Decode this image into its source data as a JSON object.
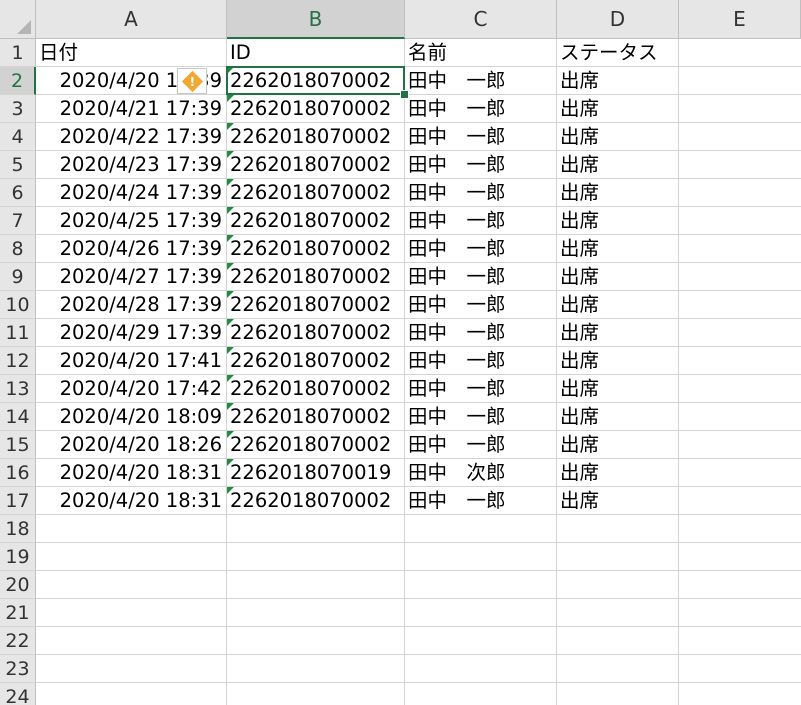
{
  "columns": [
    "A",
    "B",
    "C",
    "D",
    "E"
  ],
  "selected_column": "B",
  "row_numbers": [
    "1",
    "2",
    "3",
    "4",
    "5",
    "6",
    "7",
    "8",
    "9",
    "10",
    "11",
    "12",
    "13",
    "14",
    "15",
    "16",
    "17",
    "18",
    "19",
    "20",
    "21",
    "22",
    "23",
    "24"
  ],
  "selected_row": "2",
  "header_row": {
    "A": "日付",
    "B": "ID",
    "C": "名前",
    "D": "ステータス"
  },
  "rows": [
    {
      "date": "2020/4/20 17:39",
      "id": "2262018070002",
      "name": "田中　一郎",
      "status": "出席"
    },
    {
      "date": "2020/4/21 17:39",
      "id": "2262018070002",
      "name": "田中　一郎",
      "status": "出席"
    },
    {
      "date": "2020/4/22 17:39",
      "id": "2262018070002",
      "name": "田中　一郎",
      "status": "出席"
    },
    {
      "date": "2020/4/23 17:39",
      "id": "2262018070002",
      "name": "田中　一郎",
      "status": "出席"
    },
    {
      "date": "2020/4/24 17:39",
      "id": "2262018070002",
      "name": "田中　一郎",
      "status": "出席"
    },
    {
      "date": "2020/4/25 17:39",
      "id": "2262018070002",
      "name": "田中　一郎",
      "status": "出席"
    },
    {
      "date": "2020/4/26 17:39",
      "id": "2262018070002",
      "name": "田中　一郎",
      "status": "出席"
    },
    {
      "date": "2020/4/27 17:39",
      "id": "2262018070002",
      "name": "田中　一郎",
      "status": "出席"
    },
    {
      "date": "2020/4/28 17:39",
      "id": "2262018070002",
      "name": "田中　一郎",
      "status": "出席"
    },
    {
      "date": "2020/4/29 17:39",
      "id": "2262018070002",
      "name": "田中　一郎",
      "status": "出席"
    },
    {
      "date": "2020/4/20 17:41",
      "id": "2262018070002",
      "name": "田中　一郎",
      "status": "出席"
    },
    {
      "date": "2020/4/20 17:42",
      "id": "2262018070002",
      "name": "田中　一郎",
      "status": "出席"
    },
    {
      "date": "2020/4/20 18:09",
      "id": "2262018070002",
      "name": "田中　一郎",
      "status": "出席"
    },
    {
      "date": "2020/4/20 18:26",
      "id": "2262018070002",
      "name": "田中　一郎",
      "status": "出席"
    },
    {
      "date": "2020/4/20 18:31",
      "id": "2262018070019",
      "name": "田中　次郎",
      "status": "出席"
    },
    {
      "date": "2020/4/20 18:31",
      "id": "2262018070002",
      "name": "田中　一郎",
      "status": "出席"
    }
  ],
  "active_cell": "B2",
  "error_indicator_icon": "warning-icon",
  "colors": {
    "accent": "#217346",
    "error_triangle": "#1e8e3e",
    "warning": "#f0a830"
  }
}
